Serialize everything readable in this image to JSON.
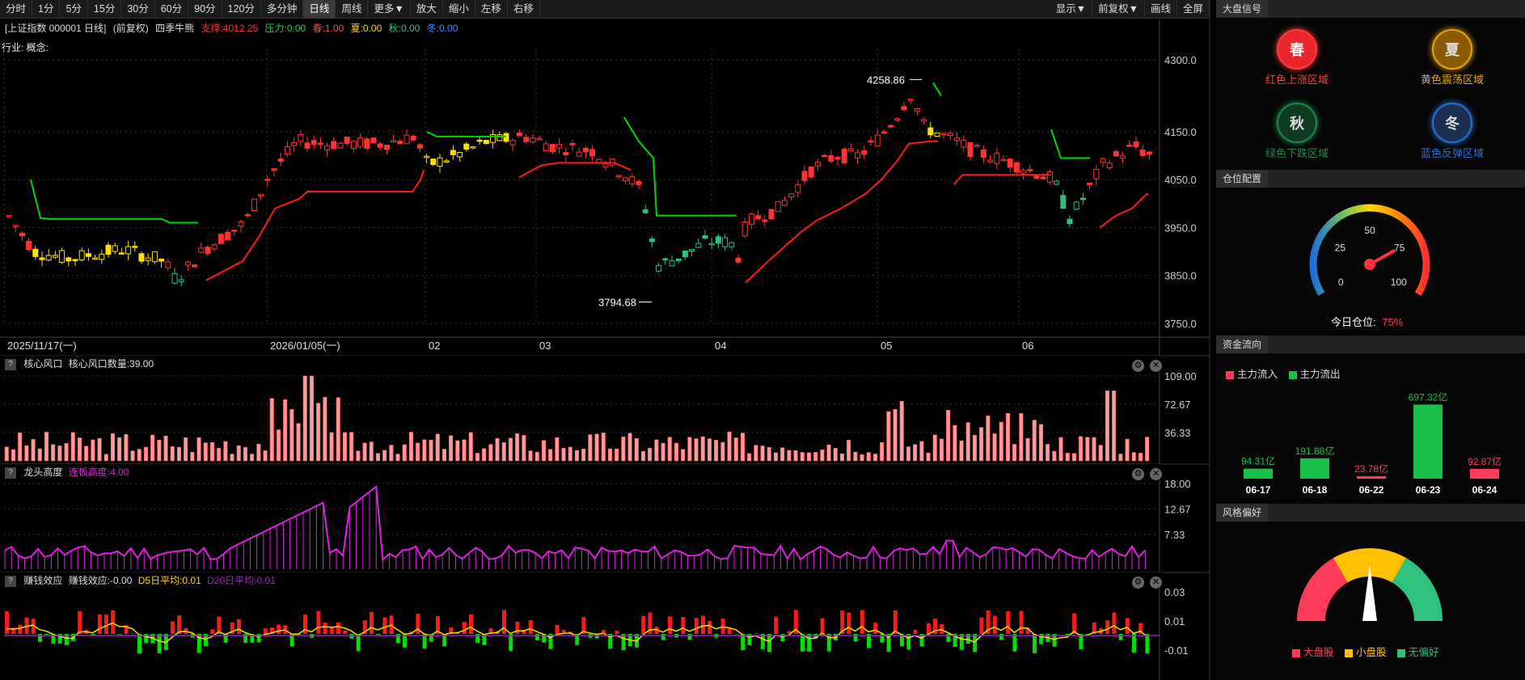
{
  "toolbar": {
    "left": [
      "分时",
      "1分",
      "5分",
      "15分",
      "30分",
      "60分",
      "90分",
      "120分",
      "多分钟",
      "日线",
      "周线",
      "更多▼",
      "放大",
      "缩小",
      "左移",
      "右移"
    ],
    "right": [
      "显示▼",
      "前复权▼",
      "画线",
      "全屏"
    ],
    "active": "日线"
  },
  "info": {
    "index": "[上证指数 000001 日线]",
    "adj": "(前复权)",
    "indicator": "四季牛熊",
    "support": "支撑:4012.25",
    "pressure": "压力:0.00",
    "spring": "春:1.00",
    "summer": "夏:0.00",
    "autumn": "秋:0.00",
    "winter": "冬:0.00",
    "industry": "行业: 概念:"
  },
  "main_chart": {
    "y_ticks": [
      "4300.0",
      "4150.0",
      "4050.0",
      "3950.0",
      "3850.0",
      "3750.0"
    ],
    "x_labels": [
      "2025/11/17(一)",
      "2026/01/05(一)",
      "02",
      "03",
      "04",
      "05",
      "06"
    ],
    "high_label": "4258.86",
    "low_label": "3794.68"
  },
  "panel1": {
    "name": "核心风口",
    "label": "核心风口数量:39.00",
    "ticks": [
      "109.00",
      "72.67",
      "36.33"
    ]
  },
  "panel2": {
    "name": "龙头高度",
    "label": "连板高度:4.00",
    "ticks": [
      "18.00",
      "12.67",
      "7.33"
    ]
  },
  "panel3": {
    "name": "赚钱效应",
    "label": "赚钱效应:-0.00",
    "d5": "D5日平均:0.01",
    "d20": "D20日平均:0.01",
    "ticks": [
      "0.03",
      "0.01",
      "-0.01"
    ]
  },
  "sidebar": {
    "signal_title": "大盘信号",
    "signals": [
      {
        "glyph": "春",
        "label": "红色上涨区域",
        "color": "#ff3b3b",
        "bg": "#e8262b"
      },
      {
        "glyph": "夏",
        "label": "黄色震荡区域",
        "color": "#e6a600",
        "bg": "#8a5a00"
      },
      {
        "glyph": "秋",
        "label": "绿色下跌区域",
        "color": "#1e8a4a",
        "bg": "#0f3a22"
      },
      {
        "glyph": "冬",
        "label": "蓝色反弹区域",
        "color": "#2a6fd6",
        "bg": "#1b3050"
      }
    ],
    "position_title": "仓位配置",
    "gauge_ticks": [
      "0",
      "25",
      "50",
      "75",
      "100"
    ],
    "position_label": "今日仓位:",
    "position_value": "75%",
    "position_pct": 75,
    "flow_title": "资金流向",
    "flow_in": "主力流入",
    "flow_out": "主力流出",
    "flows": [
      {
        "date": "06-17",
        "value": "94.31亿",
        "amount": 94.31,
        "type": "out"
      },
      {
        "date": "06-18",
        "value": "191.88亿",
        "amount": 191.88,
        "type": "out"
      },
      {
        "date": "06-22",
        "value": "23.78亿",
        "amount": 23.78,
        "type": "in"
      },
      {
        "date": "06-23",
        "value": "697.32亿",
        "amount": 697.32,
        "type": "out"
      },
      {
        "date": "06-24",
        "value": "92.87亿",
        "amount": 92.87,
        "type": "in"
      }
    ],
    "style_title": "风格偏好",
    "style_legend": [
      "大盘股",
      "小盘股",
      "无偏好"
    ]
  },
  "colors": {
    "up": "#ff3333",
    "down": "#2ec27e",
    "yellow": "#ffd400",
    "green_line": "#00e000",
    "magenta": "#e020e0"
  }
}
